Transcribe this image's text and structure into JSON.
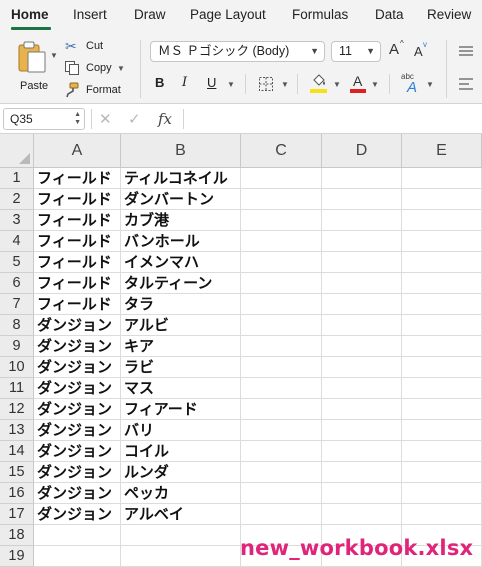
{
  "ribbon_tabs": [
    "Home",
    "Insert",
    "Draw",
    "Page Layout",
    "Formulas",
    "Data",
    "Review"
  ],
  "active_tab": "Home",
  "clipboard": {
    "paste_label": "Paste",
    "cut_label": "Cut",
    "copy_label": "Copy",
    "format_label": "Format"
  },
  "font": {
    "name": "ＭＳ Ｐゴシック (Body)",
    "size": "11",
    "grow_glyph": "A",
    "shrink_glyph": "A",
    "bold_glyph": "B",
    "italic_glyph": "I",
    "underline_glyph": "U",
    "font_color_glyph": "A",
    "highlight_color": "#f6e016",
    "font_color": "#e02020",
    "abc_glyph": "abc"
  },
  "formula_bar": {
    "name_box": "Q35",
    "fx_label": "fx",
    "cancel_glyph": "✕",
    "enter_glyph": "✓",
    "formula": ""
  },
  "columns": [
    "A",
    "B",
    "C",
    "D",
    "E"
  ],
  "rows": [
    {
      "num": "1",
      "a": "フィールド",
      "b": "ティルコネイル"
    },
    {
      "num": "2",
      "a": "フィールド",
      "b": "ダンバートン"
    },
    {
      "num": "3",
      "a": "フィールド",
      "b": "カブ港"
    },
    {
      "num": "4",
      "a": "フィールド",
      "b": "バンホール"
    },
    {
      "num": "5",
      "a": "フィールド",
      "b": "イメンマハ"
    },
    {
      "num": "6",
      "a": "フィールド",
      "b": "タルティーン"
    },
    {
      "num": "7",
      "a": "フィールド",
      "b": "タラ"
    },
    {
      "num": "8",
      "a": "ダンジョン",
      "b": "アルビ"
    },
    {
      "num": "9",
      "a": "ダンジョン",
      "b": "キア"
    },
    {
      "num": "10",
      "a": "ダンジョン",
      "b": "ラビ"
    },
    {
      "num": "11",
      "a": "ダンジョン",
      "b": "マス"
    },
    {
      "num": "12",
      "a": "ダンジョン",
      "b": "フィアード"
    },
    {
      "num": "13",
      "a": "ダンジョン",
      "b": "バリ"
    },
    {
      "num": "14",
      "a": "ダンジョン",
      "b": "コイル"
    },
    {
      "num": "15",
      "a": "ダンジョン",
      "b": "ルンダ"
    },
    {
      "num": "16",
      "a": "ダンジョン",
      "b": "ペッカ"
    },
    {
      "num": "17",
      "a": "ダンジョン",
      "b": "アルベイ"
    },
    {
      "num": "18",
      "a": "",
      "b": ""
    },
    {
      "num": "19",
      "a": "",
      "b": ""
    }
  ],
  "watermark": "new_workbook.xlsx"
}
